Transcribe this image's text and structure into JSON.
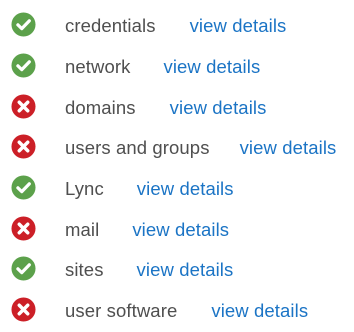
{
  "colors": {
    "success": "#5ca14b",
    "error": "#cc1f27",
    "label": "#4f4f4f",
    "link": "#1b74c5"
  },
  "items": [
    {
      "label": "credentials",
      "status": "success",
      "icon": "check-circle-icon",
      "link": "view details",
      "gap": 34
    },
    {
      "label": "network",
      "status": "success",
      "icon": "check-circle-icon",
      "link": "view details",
      "gap": 33
    },
    {
      "label": "domains",
      "status": "error",
      "icon": "x-circle-icon",
      "link": "view details",
      "gap": 34
    },
    {
      "label": "users and groups",
      "status": "error",
      "icon": "x-circle-icon",
      "link": "view details",
      "gap": 30
    },
    {
      "label": "Lync",
      "status": "success",
      "icon": "check-circle-icon",
      "link": "view details",
      "gap": 33
    },
    {
      "label": "mail",
      "status": "error",
      "icon": "x-circle-icon",
      "link": "view details",
      "gap": 33
    },
    {
      "label": "sites",
      "status": "success",
      "icon": "check-circle-icon",
      "link": "view details",
      "gap": 33
    },
    {
      "label": "user software",
      "status": "error",
      "icon": "x-circle-icon",
      "link": "view details",
      "gap": 34
    }
  ]
}
